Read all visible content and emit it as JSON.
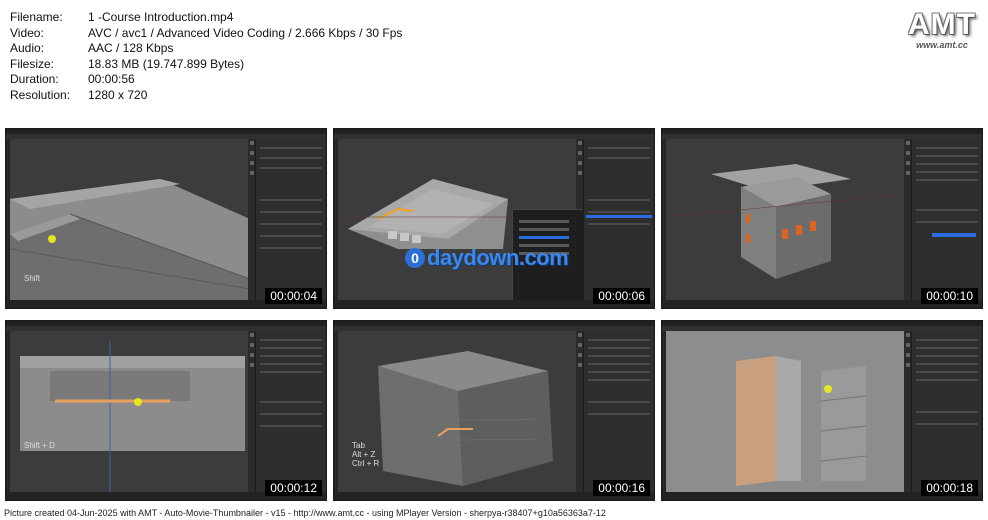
{
  "info": [
    {
      "key": "Filename:",
      "value": "1 -Course Introduction.mp4"
    },
    {
      "key": "Video:",
      "value": "AVC / avc1 / Advanced Video Coding / 2.666 Kbps / 30 Fps"
    },
    {
      "key": "Audio:",
      "value": "AAC / 128 Kbps"
    },
    {
      "key": "Filesize:",
      "value": "18.83 MB (19.747.899 Bytes)"
    },
    {
      "key": "Duration:",
      "value": "00:00:56"
    },
    {
      "key": "Resolution:",
      "value": "1280 x 720"
    }
  ],
  "logo": {
    "text": "AMT",
    "url": "www.amt.cc"
  },
  "thumbnails": [
    {
      "timestamp": "00:00:04",
      "hint": "Shift"
    },
    {
      "timestamp": "00:00:06",
      "hint": ""
    },
    {
      "timestamp": "00:00:10",
      "hint": ""
    },
    {
      "timestamp": "00:00:12",
      "hint": "Shift + D"
    },
    {
      "timestamp": "00:00:16",
      "hint": "Tab\nAlt + Z\nCtrl + R"
    },
    {
      "timestamp": "00:00:18",
      "hint": ""
    }
  ],
  "watermark": {
    "circle": "0",
    "text": "daydown.com"
  },
  "footer": "Picture created 04-Jun-2025 with AMT - Auto-Movie-Thumbnailer - v15 - http://www.amt.cc - using MPlayer Version - sherpya-r38407+g10a56363a7-12"
}
